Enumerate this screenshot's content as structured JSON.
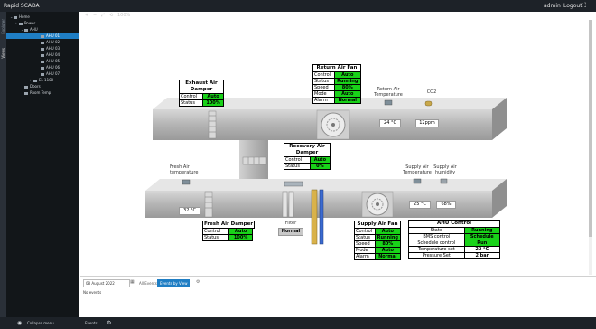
{
  "topbar": {
    "title": "Rapid SCADA",
    "user": "admin",
    "logout": "Logout",
    "fullscreen_icon": "⛶"
  },
  "rail": {
    "tab_explorer": "Explorer",
    "tab_views": "Views"
  },
  "sidebar": {
    "items": [
      {
        "label": "Home",
        "icon": "home-icon"
      },
      {
        "label": "Power",
        "icon": "folder-icon"
      },
      {
        "label": "AHU",
        "icon": "folder-icon"
      },
      {
        "label": "AHU 01",
        "icon": "view-icon",
        "selected": true
      },
      {
        "label": "AHU 02",
        "icon": "view-icon"
      },
      {
        "label": "AHU 03",
        "icon": "view-icon"
      },
      {
        "label": "AHU 04",
        "icon": "view-icon"
      },
      {
        "label": "AHU 05",
        "icon": "view-icon"
      },
      {
        "label": "AHU 06",
        "icon": "view-icon"
      },
      {
        "label": "AHU 07",
        "icon": "view-icon"
      },
      {
        "label": "EL 1100",
        "icon": "folder-icon"
      },
      {
        "label": "Doors",
        "icon": "view-icon"
      },
      {
        "label": "Room Temp",
        "icon": "view-icon"
      }
    ]
  },
  "toolbar": {
    "zoom": "100%"
  },
  "schematic": {
    "return_fan": {
      "title": "Return Air Fan",
      "rows": [
        [
          "Control",
          "Auto"
        ],
        [
          "Status",
          "Running"
        ],
        [
          "Speed",
          "80%"
        ],
        [
          "Mode",
          "Auto"
        ],
        [
          "Alarm",
          "Normal"
        ]
      ]
    },
    "exhaust_damper": {
      "title": "Exhaust Air Damper",
      "rows": [
        [
          "Control",
          "Auto"
        ],
        [
          "Status",
          "100%"
        ]
      ]
    },
    "recovery_damper": {
      "title": "Recovery Air Damper",
      "rows": [
        [
          "Control",
          "Auto"
        ],
        [
          "Status",
          "0%"
        ]
      ]
    },
    "fresh_damper": {
      "title": "Fresh Air Damper",
      "rows": [
        [
          "Control",
          "Auto"
        ],
        [
          "Status",
          "100%"
        ]
      ]
    },
    "supply_fan": {
      "title": "Supply Air Fan",
      "rows": [
        [
          "Control",
          "Auto"
        ],
        [
          "Status",
          "Running"
        ],
        [
          "Speed",
          "80%"
        ],
        [
          "Mode",
          "Auto"
        ],
        [
          "Alarm",
          "Normal"
        ]
      ]
    },
    "ahu_control": {
      "title": "AHU Control",
      "rows": [
        [
          "State",
          "Running"
        ],
        [
          "BMS control",
          "Schedule"
        ],
        [
          "Schedule control",
          "Run"
        ],
        [
          "Temperature set",
          "22 °C"
        ],
        [
          "Pressure Set",
          "2 bar"
        ]
      ]
    },
    "filter": {
      "label": "Filter",
      "value": "Normal"
    },
    "return_temp": {
      "label": "Return Air Temperature",
      "value": "24 °C"
    },
    "co2": {
      "label": "CO2",
      "value": "12ppm"
    },
    "fresh_temp": {
      "label": "Fresh Air temperature",
      "value": "32 °C"
    },
    "supply_temp": {
      "label": "Supply Air Temperature",
      "value": "25 °C"
    },
    "supply_humidity": {
      "label": "Supply Air humidity",
      "value": "68%"
    }
  },
  "events": {
    "date": "08 August 2022",
    "all_events_tab": "All Events",
    "events_by_view_tab": "Events by View",
    "no_events": "No events"
  },
  "bottombar": {
    "collapse": "Collapse menu",
    "events_label": "Events"
  },
  "colors": {
    "status_green": "#19d219",
    "topbar": "#1d2228",
    "sidebar": "#121619",
    "selected": "#1f7ec4",
    "duct": "#b9b9b9"
  }
}
